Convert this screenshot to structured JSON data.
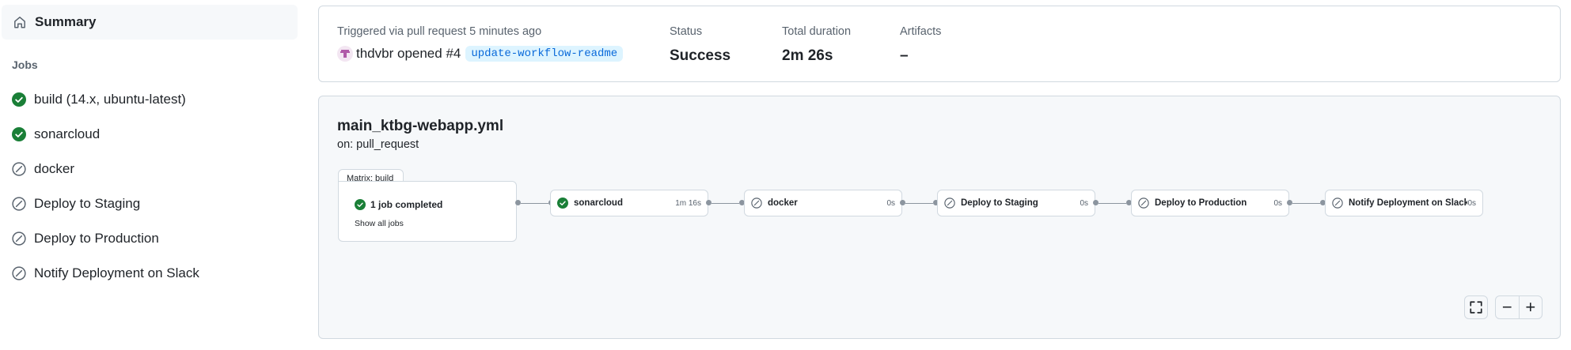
{
  "sidebar": {
    "summary_label": "Summary",
    "jobs_heading": "Jobs",
    "jobs": [
      {
        "label": "build (14.x, ubuntu-latest)",
        "status": "success"
      },
      {
        "label": "sonarcloud",
        "status": "success"
      },
      {
        "label": "docker",
        "status": "skipped"
      },
      {
        "label": "Deploy to Staging",
        "status": "skipped"
      },
      {
        "label": "Deploy to Production",
        "status": "skipped"
      },
      {
        "label": "Notify Deployment on Slack",
        "status": "skipped"
      }
    ]
  },
  "run": {
    "trigger_text": "Triggered via pull request 5 minutes ago",
    "actor": "thdvbr",
    "action": "opened",
    "pr_number": "#4",
    "branch": "update-workflow-readme",
    "status_label": "Status",
    "status_value": "Success",
    "duration_label": "Total duration",
    "duration_value": "2m 26s",
    "artifacts_label": "Artifacts",
    "artifacts_value": "–"
  },
  "workflow": {
    "file_name": "main_ktbg-webapp.yml",
    "trigger": "on: pull_request",
    "matrix": {
      "tab_label": "Matrix: build",
      "completed_text": "1 job completed",
      "show_all_label": "Show all jobs"
    },
    "nodes": [
      {
        "name": "sonarcloud",
        "duration": "1m 16s",
        "status": "success"
      },
      {
        "name": "docker",
        "duration": "0s",
        "status": "skipped"
      },
      {
        "name": "Deploy to Staging",
        "duration": "0s",
        "status": "skipped"
      },
      {
        "name": "Deploy to Production",
        "duration": "0s",
        "status": "skipped"
      },
      {
        "name": "Notify Deployment on Slack",
        "duration": "0s",
        "status": "skipped"
      }
    ]
  },
  "controls": {
    "fullscreen_icon": "fullscreen-icon",
    "zoom_out_label": "−",
    "zoom_in_label": "+"
  },
  "colors": {
    "success": "#1a7f37",
    "skipped": "#59636e",
    "branch_bg": "#ddf4ff",
    "branch_text": "#0969da"
  }
}
